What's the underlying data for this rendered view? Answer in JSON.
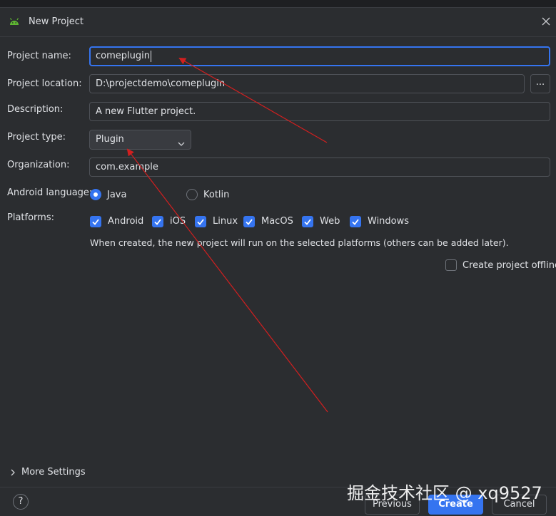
{
  "window": {
    "title": "New Project"
  },
  "form": {
    "project_name": {
      "label": "Project name:",
      "value": "comeplugin"
    },
    "project_location": {
      "label": "Project location:",
      "value": "D:\\projectdemo\\comeplugin",
      "browse_label": "..."
    },
    "description": {
      "label": "Description:",
      "value": "A new Flutter project."
    },
    "project_type": {
      "label": "Project type:",
      "value": "Plugin"
    },
    "organization": {
      "label": "Organization:",
      "value": "com.example"
    },
    "android_language": {
      "label": "Android language:",
      "options": [
        {
          "label": "Java",
          "selected": true
        },
        {
          "label": "Kotlin",
          "selected": false
        }
      ]
    },
    "platforms": {
      "label": "Platforms:",
      "items": [
        {
          "label": "Android",
          "checked": true
        },
        {
          "label": "iOS",
          "checked": true
        },
        {
          "label": "Linux",
          "checked": true
        },
        {
          "label": "MacOS",
          "checked": true
        },
        {
          "label": "Web",
          "checked": true
        },
        {
          "label": "Windows",
          "checked": true
        }
      ],
      "hint": "When created, the new project will run on the selected platforms (others can be added later)."
    },
    "offline": {
      "label": "Create project offline",
      "checked": false
    }
  },
  "footer": {
    "more_settings": "More Settings",
    "help_label": "?",
    "previous": "Previous",
    "create": "Create",
    "cancel": "Cancel"
  },
  "watermark": "掘金技术社区 @ xq9527",
  "colors": {
    "accent": "#3574f0",
    "background": "#2b2d30",
    "annotation_arrow": "#d21f1f"
  }
}
